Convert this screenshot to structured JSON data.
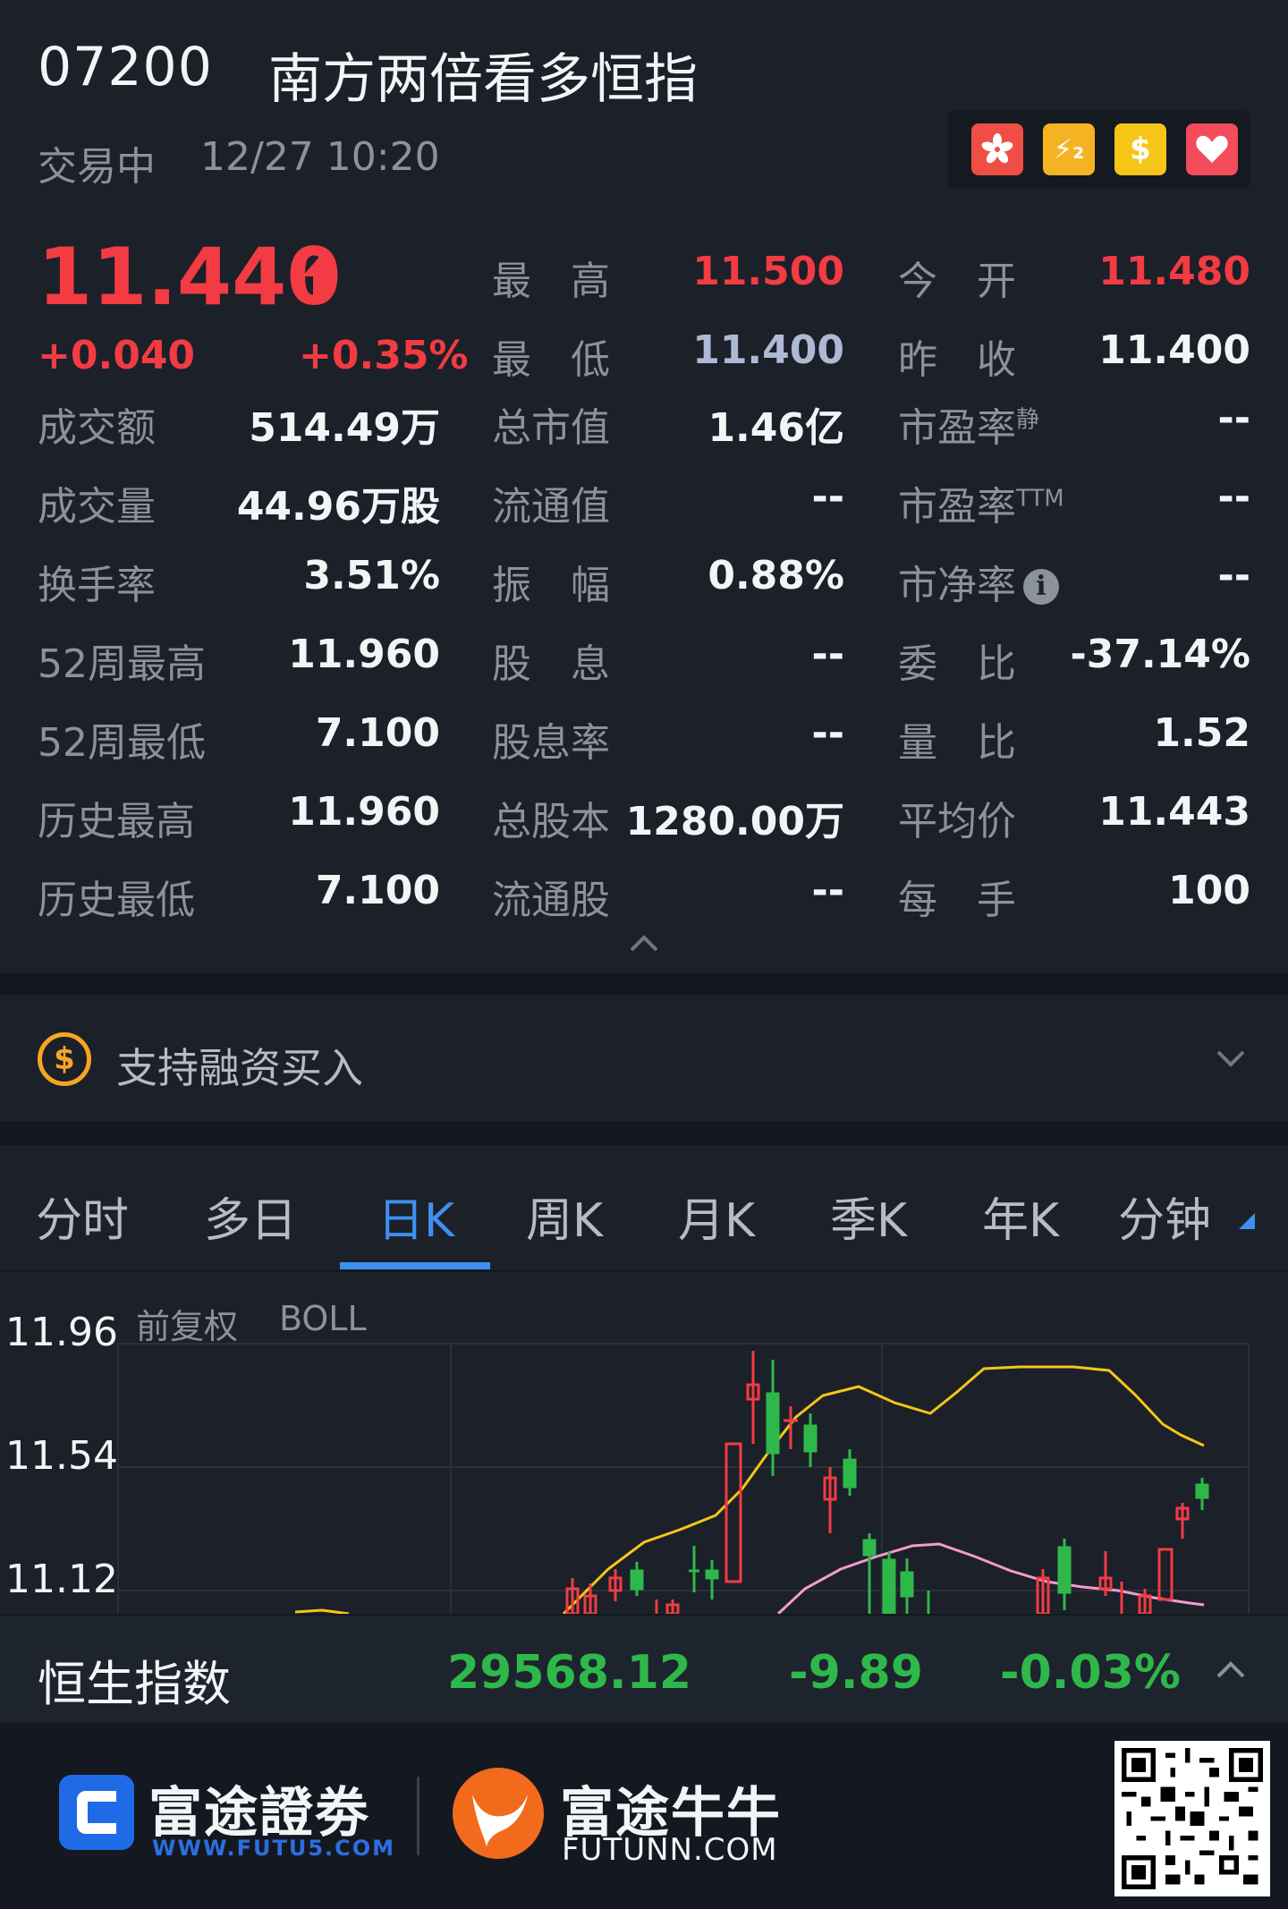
{
  "header": {
    "code": "07200",
    "name": "南方两倍看多恒指",
    "status": "交易中",
    "time": "12/27 10:20",
    "badges": [
      {
        "icon": "hk-flag-icon",
        "color": "#f04e45"
      },
      {
        "icon": "level2-icon",
        "color": "#f5b324",
        "label": "⚡₂"
      },
      {
        "icon": "dollar-icon",
        "color": "#f5c518",
        "label": "$"
      },
      {
        "icon": "heart-icon",
        "color": "#f44c5a"
      }
    ]
  },
  "quote": {
    "price": "11.440",
    "change": "+0.040",
    "change_pct": "+0.35%",
    "rows": [
      {
        "l1": "最　高",
        "v1": "11.500",
        "l2": "今　开",
        "v2": "11.480"
      },
      {
        "l1": "最　低",
        "v1": "11.400",
        "l2": "昨　收",
        "v2": "11.400"
      }
    ],
    "stats": [
      {
        "a_l": "成交额",
        "a_v": "514.49万",
        "b_l": "总市值",
        "b_v": "1.46亿",
        "c_l": "市盈率",
        "c_sup": "静",
        "c_v": "--"
      },
      {
        "a_l": "成交量",
        "a_v": "44.96万股",
        "b_l": "流通值",
        "b_v": "--",
        "c_l": "市盈率",
        "c_sup": "TTM",
        "c_v": "--"
      },
      {
        "a_l": "换手率",
        "a_v": "3.51%",
        "b_l": "振　幅",
        "b_v": "0.88%",
        "c_l": "市净率",
        "c_sup": "",
        "c_v": "--"
      },
      {
        "a_l": "52周最高",
        "a_v": "11.960",
        "b_l": "股　息",
        "b_v": "--",
        "c_l": "委　比",
        "c_sup": "",
        "c_v": "-37.14%"
      },
      {
        "a_l": "52周最低",
        "a_v": "7.100",
        "b_l": "股息率",
        "b_v": "--",
        "c_l": "量　比",
        "c_sup": "",
        "c_v": "1.52"
      },
      {
        "a_l": "历史最高",
        "a_v": "11.960",
        "b_l": "总股本",
        "b_v": "1280.00万",
        "c_l": "平均价",
        "c_sup": "",
        "c_v": "11.443"
      },
      {
        "a_l": "历史最低",
        "a_v": "7.100",
        "b_l": "流通股",
        "b_v": "--",
        "c_l": "每　手",
        "c_sup": "",
        "c_v": "100"
      }
    ],
    "info_glyph": "i"
  },
  "margin": {
    "label": "支持融资买入",
    "icon_glyph": "$"
  },
  "tabs": [
    "分时",
    "多日",
    "日K",
    "周K",
    "月K",
    "季K",
    "年K",
    "分钟"
  ],
  "active_tab": "日K",
  "chart": {
    "y_ticks": [
      "11.96",
      "11.54",
      "11.12"
    ],
    "adj_label": "前复权",
    "indicator": "BOLL",
    "colors": {
      "up": "#f23b42",
      "down": "#2fb84a",
      "upper": "#f5c518",
      "middle": "#f29bd1"
    }
  },
  "index": {
    "name": "恒生指数",
    "value": "29568.12",
    "change": "-9.89",
    "change_pct": "-0.03%"
  },
  "footer": {
    "brand1": "富途證劵",
    "brand1_url": "WWW.FUTU5.COM",
    "brand2": "富途牛牛",
    "brand2_url": "FUTUNN.COM"
  },
  "colors": {
    "bg": "#1b2029",
    "up": "#f23b42",
    "down": "#2fb84a",
    "accent": "#3f8ff0"
  }
}
